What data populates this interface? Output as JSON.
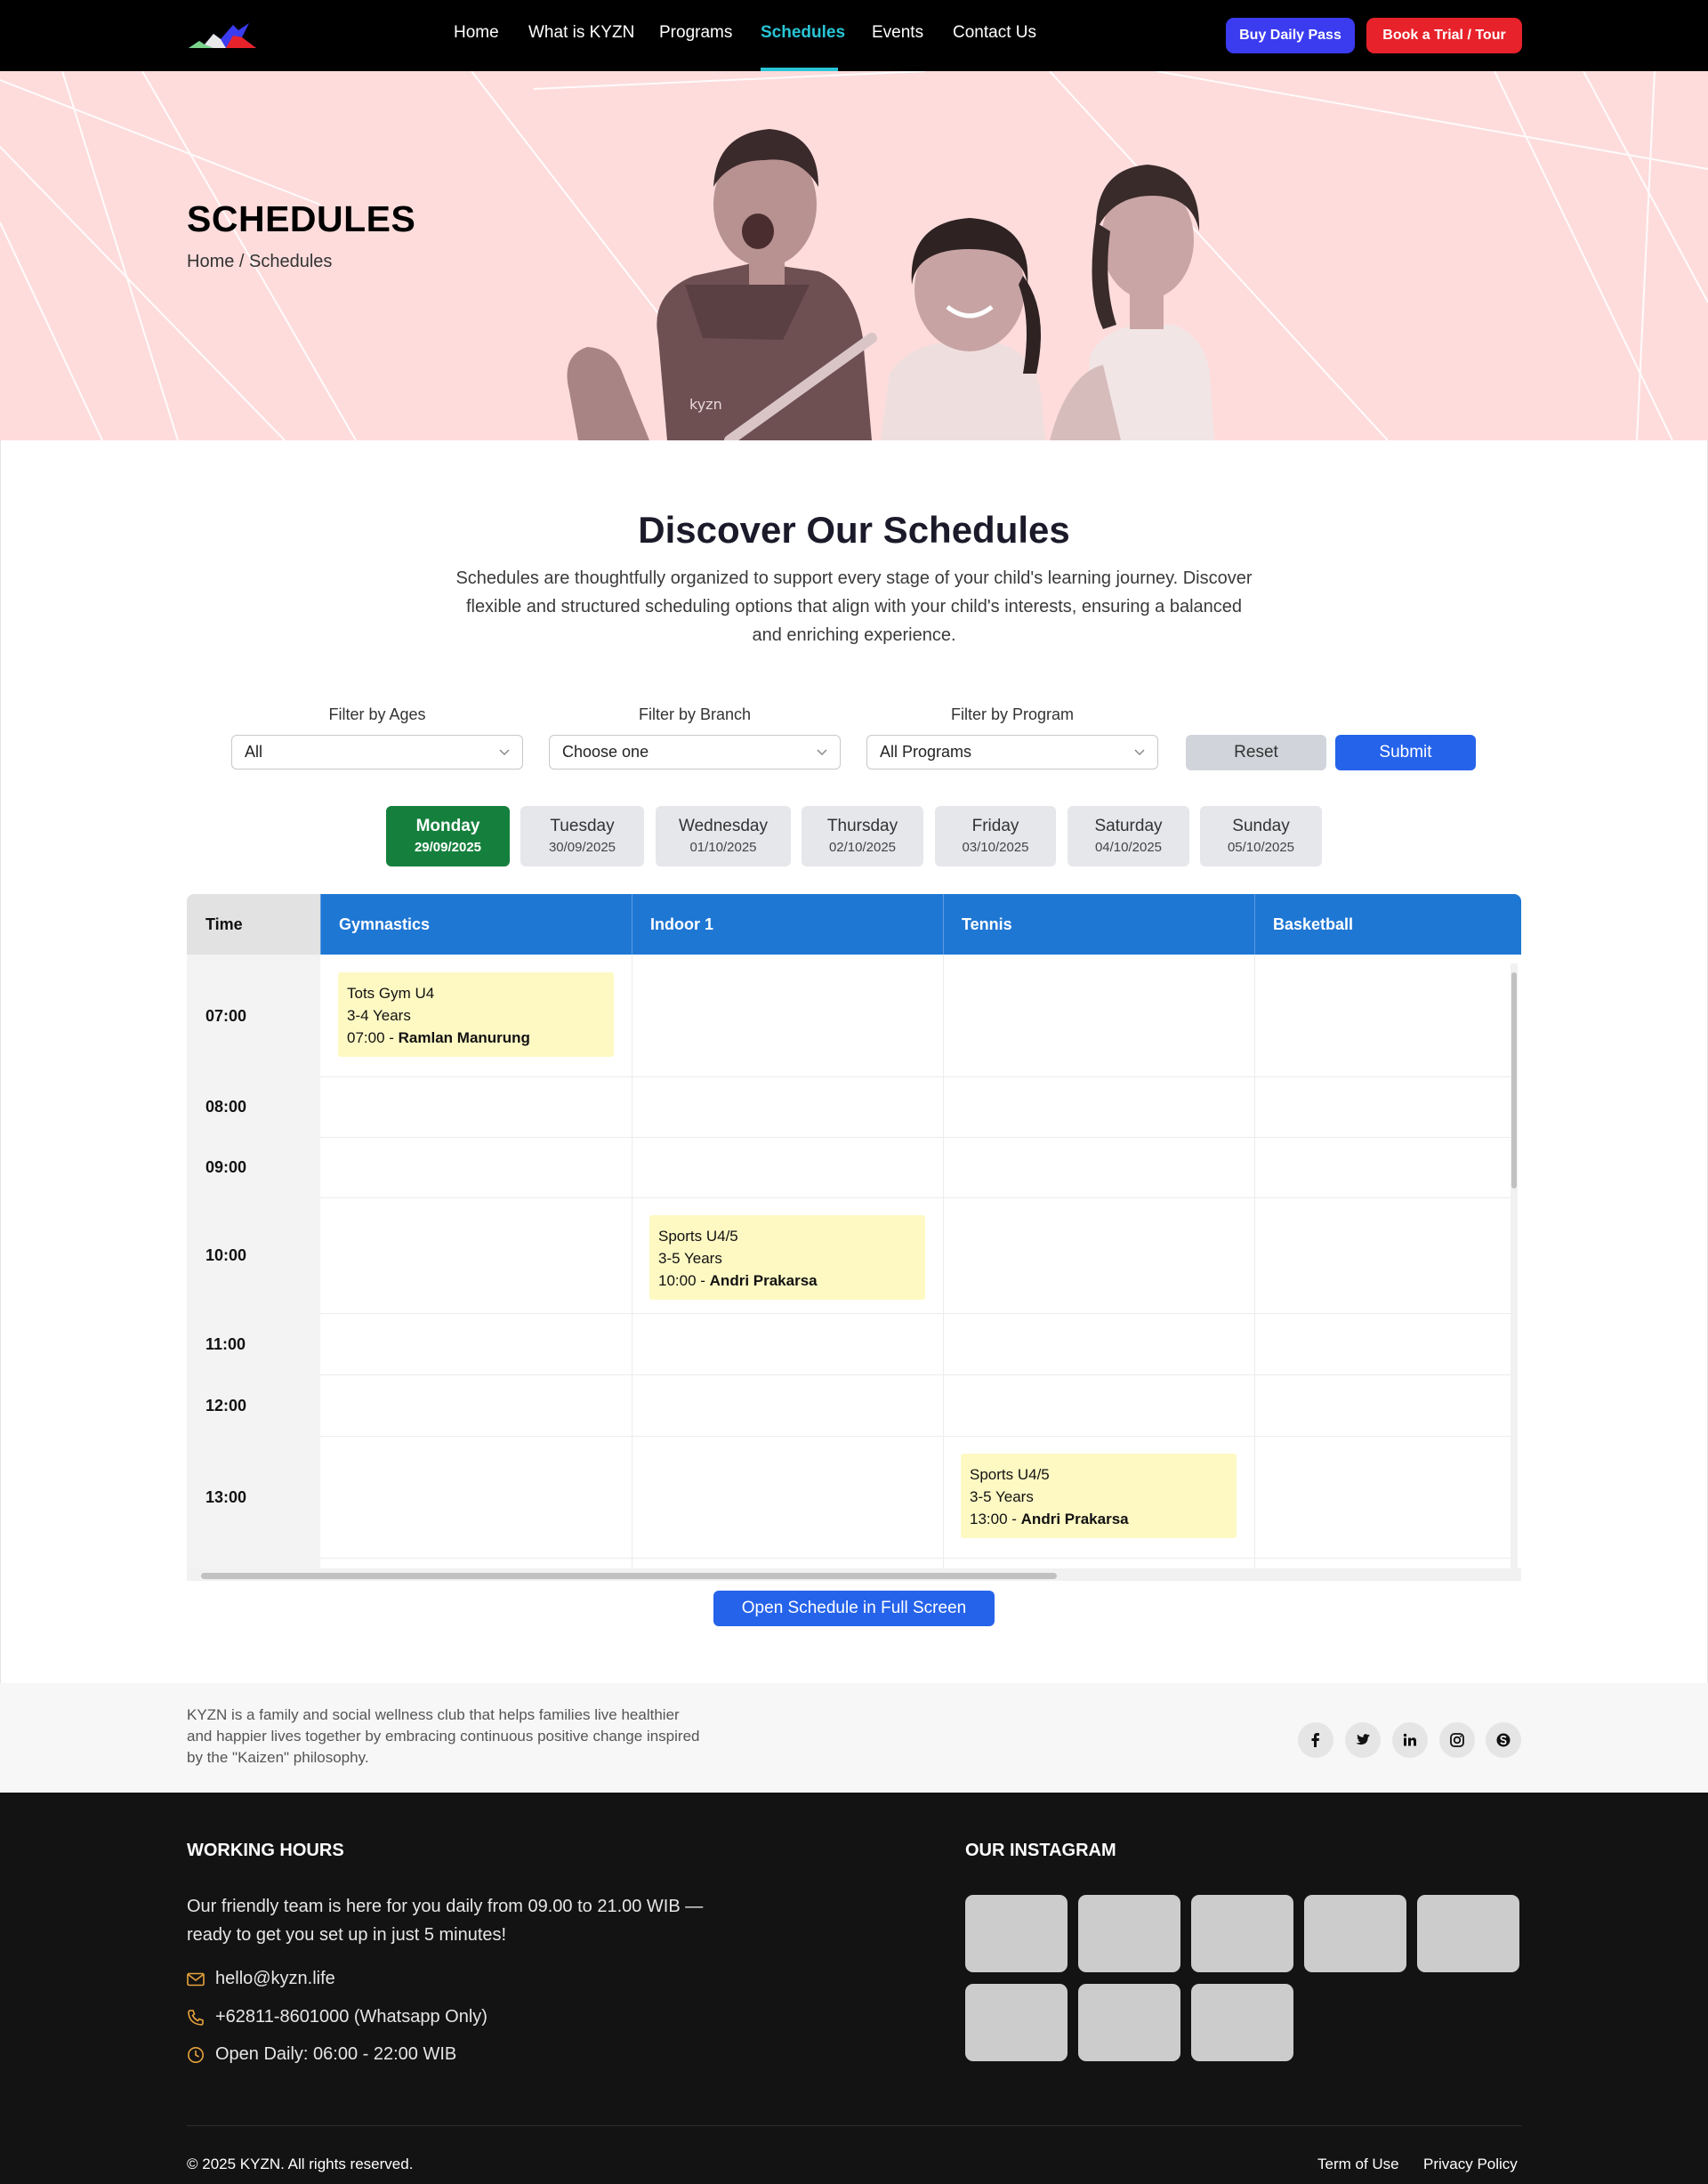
{
  "nav": {
    "links": [
      {
        "label": "Home",
        "active": false
      },
      {
        "label": "What is KYZN",
        "active": false
      },
      {
        "label": "Programs",
        "active": false
      },
      {
        "label": "Schedules",
        "active": true
      },
      {
        "label": "Events",
        "active": false
      },
      {
        "label": "Contact Us",
        "active": false
      }
    ],
    "buy_pass_label": "Buy Daily Pass",
    "trial_label": "Book a Trial / Tour"
  },
  "hero": {
    "title": "SCHEDULES",
    "breadcrumb": "Home / Schedules",
    "shirt_text": "kyzn"
  },
  "intro": {
    "title": "Discover Our Schedules",
    "description": "Schedules are thoughtfully organized to support every stage of your child's learning journey. Discover flexible and structured scheduling options that align with your child's interests, ensuring a balanced and enriching experience."
  },
  "filters": {
    "ages": {
      "label": "Filter by Ages",
      "value": "All"
    },
    "branch": {
      "label": "Filter by Branch",
      "value": "Choose one"
    },
    "program": {
      "label": "Filter by Program",
      "value": "All Programs"
    },
    "reset_label": "Reset",
    "submit_label": "Submit"
  },
  "days": [
    {
      "name": "Monday",
      "date": "29/09/2025",
      "active": true
    },
    {
      "name": "Tuesday",
      "date": "30/09/2025",
      "active": false
    },
    {
      "name": "Wednesday",
      "date": "01/10/2025",
      "active": false
    },
    {
      "name": "Thursday",
      "date": "02/10/2025",
      "active": false
    },
    {
      "name": "Friday",
      "date": "03/10/2025",
      "active": false
    },
    {
      "name": "Saturday",
      "date": "04/10/2025",
      "active": false
    },
    {
      "name": "Sunday",
      "date": "05/10/2025",
      "active": false
    }
  ],
  "schedule": {
    "time_header": "Time",
    "columns": [
      "Gymnastics",
      "Indoor 1",
      "Tennis",
      "Basketball"
    ],
    "times": [
      "07:00",
      "08:00",
      "09:00",
      "10:00",
      "11:00",
      "12:00",
      "13:00"
    ],
    "events": [
      {
        "title": "Tots Gym U4",
        "ages": "3-4 Years",
        "start": "07:00",
        "teacher": "Ramlan Manurung",
        "column": "Gymnastics"
      },
      {
        "title": "Sports U4/5",
        "ages": "3-5 Years",
        "start": "10:00",
        "teacher": "Andri Prakarsa",
        "column": "Indoor 1"
      },
      {
        "title": "Sports U4/5",
        "ages": "3-5 Years",
        "start": "13:00",
        "teacher": "Andri Prakarsa",
        "column": "Tennis"
      }
    ],
    "fullscreen_label": "Open Schedule in Full Screen"
  },
  "about": {
    "text": "KYZN is a family and social wellness club that helps families live healthier and happier lives together by embracing continuous positive change inspired by the \"Kaizen\" philosophy.",
    "social_icons": [
      "facebook-icon",
      "twitter-icon",
      "linkedin-icon",
      "instagram-icon",
      "skype-icon"
    ]
  },
  "footer": {
    "hours_heading": "WORKING HOURS",
    "hours_text": "Our friendly team is here for you daily from 09.00 to 21.00 WIB — ready to get you set up in just 5 minutes!",
    "email": "hello@kyzn.life",
    "phone": "+62811-8601000 (Whatsapp Only)",
    "open_hours": "Open Daily: 06:00 - 22:00 WIB",
    "instagram_heading": "OUR INSTAGRAM",
    "instagram_tiles": 8,
    "copyright": "© 2025 KYZN. All rights reserved.",
    "terms_label": "Term of Use",
    "privacy_label": "Privacy Policy"
  },
  "colors": {
    "accent_cyan": "#29c5d6",
    "buy_pass_blue": "#3b3bf0",
    "trial_red": "#e8222a",
    "hero_pink": "#fedcdc",
    "column_header_blue": "#1f77d4",
    "active_day_green": "#15803d",
    "event_yellow": "#fef9c3",
    "primary_button_blue": "#2563eb",
    "footer_dark": "#131313"
  }
}
